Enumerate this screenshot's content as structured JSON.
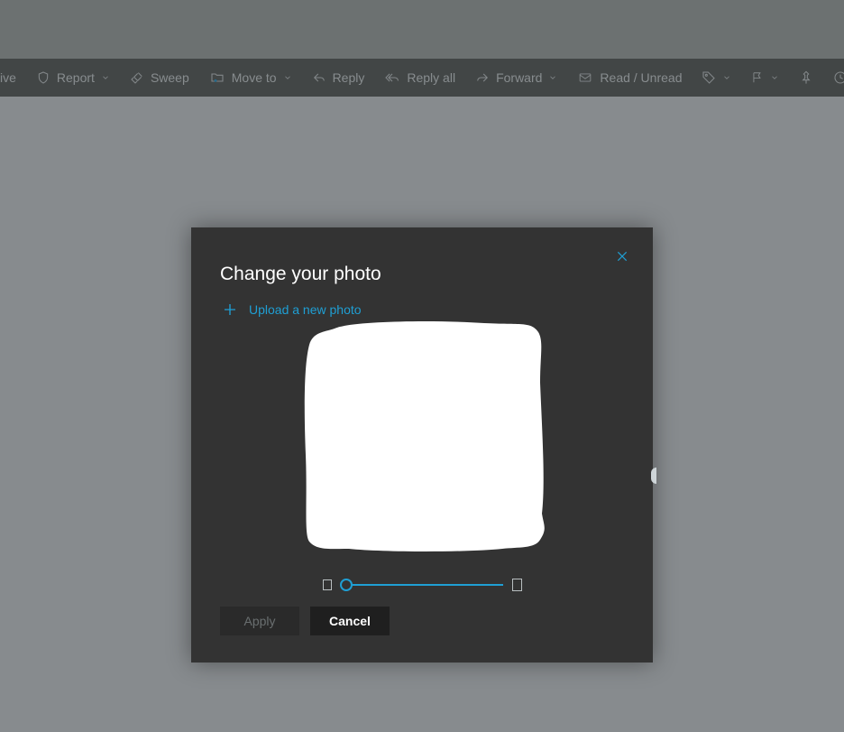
{
  "toolbar": {
    "fragment_left": "ive",
    "report": "Report",
    "sweep": "Sweep",
    "move_to": "Move to",
    "reply": "Reply",
    "reply_all": "Reply all",
    "forward": "Forward",
    "read_unread": "Read / Unread"
  },
  "modal": {
    "title": "Change your photo",
    "upload_label": "Upload a new photo",
    "apply_label": "Apply",
    "cancel_label": "Cancel"
  },
  "colors": {
    "accent": "#1f9fd4",
    "modal_bg": "#333333",
    "page_bg": "#cfd6da",
    "toolbar_bg": "#666c6c"
  },
  "slider": {
    "value": 0,
    "min": 0,
    "max": 100
  }
}
